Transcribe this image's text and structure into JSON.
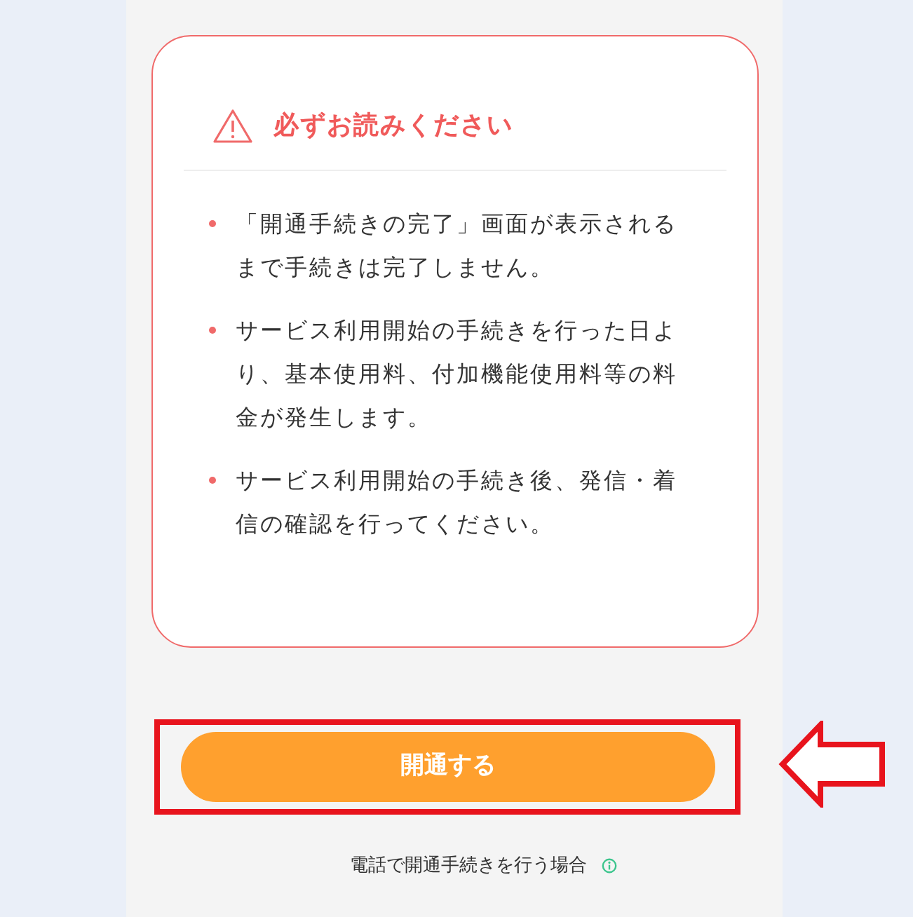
{
  "notice": {
    "title": "必ずお読みください",
    "items": [
      "「開通手続きの完了」画面が表示されるまで手続きは完了しません。",
      "サービス利用開始の手続きを行った日より、基本使用料、付加機能使用料等の料金が発生します。",
      "サービス利用開始の手続き後、発信・着信の確認を行ってください。"
    ]
  },
  "primary_button": {
    "label": "開通する",
    "highlighted": true
  },
  "phone_link": {
    "label": "電話で開通手続きを行う場合"
  }
}
